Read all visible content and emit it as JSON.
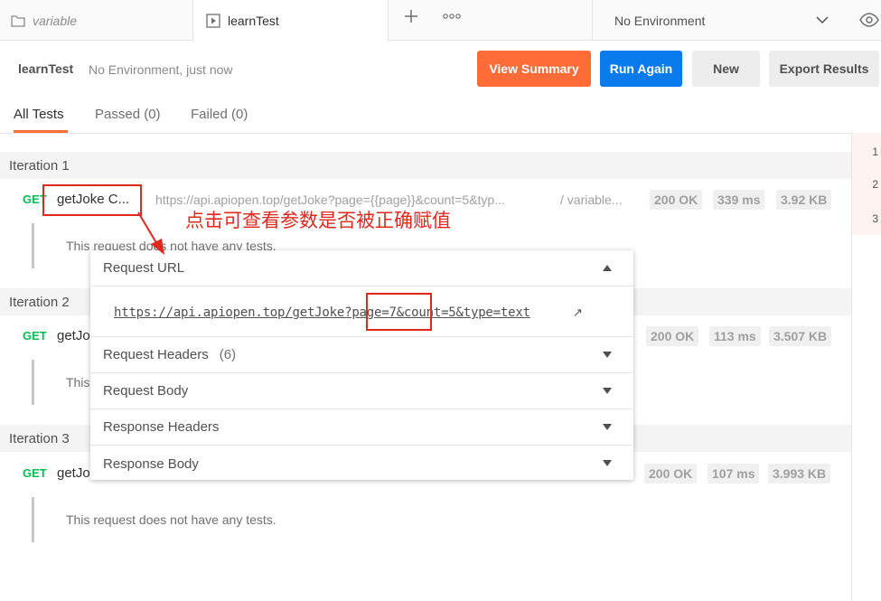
{
  "tabs": [
    {
      "label": "variable"
    },
    {
      "label": "learnTest"
    }
  ],
  "environment": {
    "selected": "No Environment"
  },
  "runner": {
    "title": "learnTest",
    "meta": "No Environment, just now",
    "buttons": {
      "view_summary": "View Summary",
      "run_again": "Run Again",
      "new": "New",
      "export": "Export Results"
    }
  },
  "filters": {
    "all": "All Tests",
    "passed": "Passed (0)",
    "failed": "Failed (0)"
  },
  "minimap": [
    "1",
    "2",
    "3"
  ],
  "iterations": [
    {
      "label": "Iteration 1",
      "method": "GET",
      "name": "getJoke C...",
      "url": "https://api.apiopen.top/getJoke?page={{page}}&count=5&typ...",
      "collection": "/ variable...",
      "status": "200 OK",
      "time": "339 ms",
      "size": "3.92 KB",
      "note": "This request does not have any tests."
    },
    {
      "label": "Iteration 2",
      "method": "GET",
      "name": "getJo",
      "status": "200 OK",
      "time": "113 ms",
      "size": "3.507 KB",
      "note": "This"
    },
    {
      "label": "Iteration 3",
      "method": "GET",
      "name": "getJo",
      "status": "200 OK",
      "time": "107 ms",
      "size": "3.993 KB",
      "note": "This request does not have any tests."
    }
  ],
  "popover": {
    "request_url_label": "Request URL",
    "full_url": "https://api.apiopen.top/getJoke?page=7&count=5&type=text",
    "request_headers_label": "Request Headers",
    "request_headers_count": "(6)",
    "request_body_label": "Request Body",
    "response_headers_label": "Response Headers",
    "response_body_label": "Response Body"
  },
  "annotation": {
    "text": "点击可查看参数是否被正确赋值",
    "color": "#e0281e"
  },
  "colors": {
    "accent_orange": "#ff6c37",
    "accent_blue": "#097bed",
    "get_green": "#0cbb52"
  }
}
